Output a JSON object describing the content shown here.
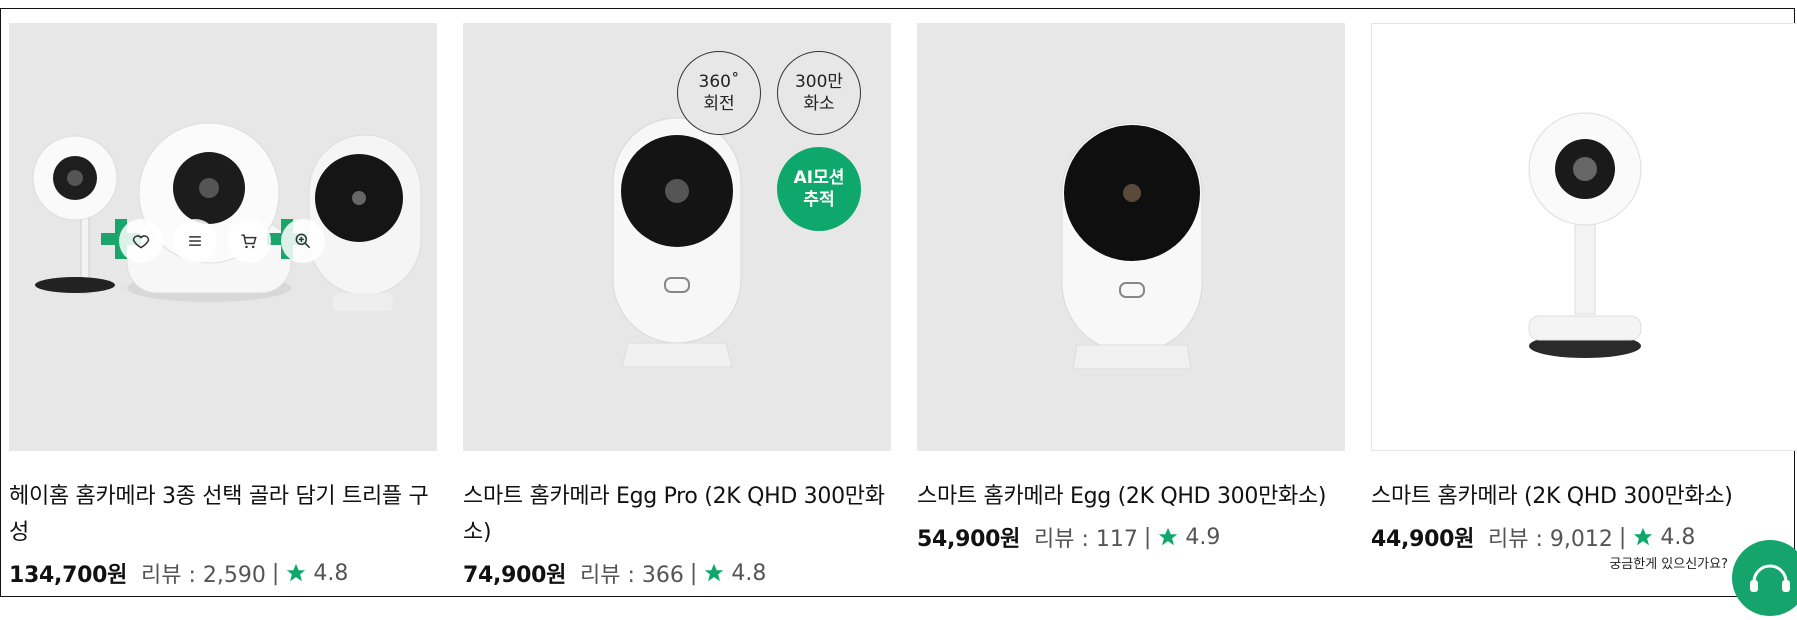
{
  "products": [
    {
      "name": "헤이홈 홈카메라 3종 선택 골라 담기 트리플 구성",
      "price": "134,700원",
      "review": "리뷰 : 2,590",
      "rating": "4.8"
    },
    {
      "name": "스마트 홈카메라 Egg Pro (2K QHD 300만화소)",
      "price": "74,900원",
      "review": "리뷰 : 366",
      "rating": "4.8",
      "badges": [
        "360˚\n회전",
        "300만\n화소",
        "AI모션\n추적"
      ]
    },
    {
      "name": "스마트 홈카메라 Egg (2K QHD 300만화소)",
      "price": "54,900원",
      "review": "리뷰 : 117",
      "rating": "4.9"
    },
    {
      "name": "스마트 홈카메라 (2K QHD 300만화소)",
      "price": "44,900원",
      "review": "리뷰 : 9,012",
      "rating": "4.8"
    }
  ],
  "separator": "|",
  "help": {
    "label": "궁금한게 있으신가요?"
  },
  "colors": {
    "accent": "#0fa86c",
    "thumb_bg": "#e7e7e7",
    "star": "#0fa86c"
  },
  "icons": [
    "heart-icon",
    "menu-icon",
    "cart-icon",
    "zoom-icon",
    "star-icon",
    "headset-icon"
  ]
}
